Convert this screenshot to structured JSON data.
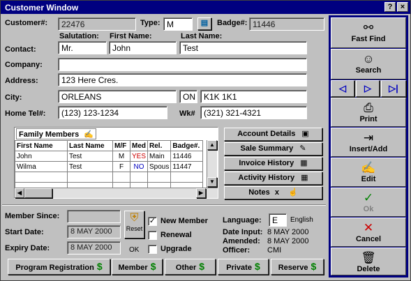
{
  "window": {
    "title": "Customer Window",
    "help_btn": "?",
    "close_btn": "×"
  },
  "header": {
    "customer_label": "Customer#:",
    "customer_value": "22476",
    "type_label": "Type:",
    "type_value": "M",
    "badge_label": "Badge#:",
    "badge_value": "11446"
  },
  "contact": {
    "salutation_label": "Salutation:",
    "first_name_label": "First Name:",
    "last_name_label": "Last Name:",
    "contact_label": "Contact:",
    "salutation": "Mr.",
    "first_name": "John",
    "last_name": "Test",
    "company_label": "Company:",
    "company": "",
    "address_label": "Address:",
    "address": "123 Here Cres.",
    "city_label": "City:",
    "city": "ORLEANS",
    "province": "ON",
    "postal": "K1K 1K1",
    "home_tel_label": "Home Tel#:",
    "home_tel": "(123) 123-1234",
    "work_label": "Wk#",
    "work_tel": "(321) 321-4321"
  },
  "family": {
    "title": "Family Members",
    "headers": [
      "First Name",
      "Last Name",
      "M/F",
      "Med",
      "Rel.",
      "Badge#."
    ],
    "rows": [
      [
        "John",
        "Test",
        "M",
        "YES",
        "Main",
        "11446"
      ],
      [
        "Wilma",
        "Test",
        "F",
        "NO",
        "Spous",
        "11447"
      ]
    ]
  },
  "actions": {
    "account_details": "Account Details",
    "sale_summary": "Sale Summary",
    "invoice_history": "Invoice History",
    "activity_history": "Activity History",
    "notes": "Notes",
    "notes_x": "x"
  },
  "membership": {
    "member_since_label": "Member Since:",
    "member_since": "",
    "start_date_label": "Start Date:",
    "start_date": "8 MAY 2000",
    "expiry_date_label": "Expiry Date:",
    "expiry_date": "8 MAY 2000",
    "reset_label": "Reset",
    "ok_label": "OK",
    "new_member_label": "New Member",
    "renewal_label": "Renewal",
    "upgrade_label": "Upgrade",
    "language_label": "Language:",
    "language_code": "E",
    "language_name": "English",
    "date_input_label": "Date Input:",
    "date_input": "8 MAY 2000",
    "amended_label": "Amended:",
    "amended": "8 MAY 2000",
    "officer_label": "Officer:",
    "officer": "CMI"
  },
  "bottom": {
    "program_registration": "Program Registration",
    "member": "Member",
    "other": "Other",
    "private": "Private",
    "reserve": "Reserve",
    "dollar": "$"
  },
  "sidebar": {
    "fast_find": "Fast Find",
    "search": "Search",
    "print": "Print",
    "insert_add": "Insert/Add",
    "edit": "Edit",
    "ok": "Ok",
    "cancel": "Cancel",
    "delete": "Delete"
  },
  "icons": [
    "binoculars-icon",
    "search-face-icon",
    "nav-prev-icon",
    "nav-next-icon",
    "nav-last-icon",
    "printer-icon",
    "insert-icon",
    "edit-icon",
    "check-icon",
    "cancel-x-icon",
    "trash-icon",
    "reset-shield-icon",
    "phone-icon"
  ],
  "colors": {
    "title_bar": "#000080",
    "face": "#c0c0c0",
    "dollar": "#008000",
    "nav_arrow": "#0000c0",
    "cancel_x": "#cc0000",
    "check": "#008000"
  }
}
